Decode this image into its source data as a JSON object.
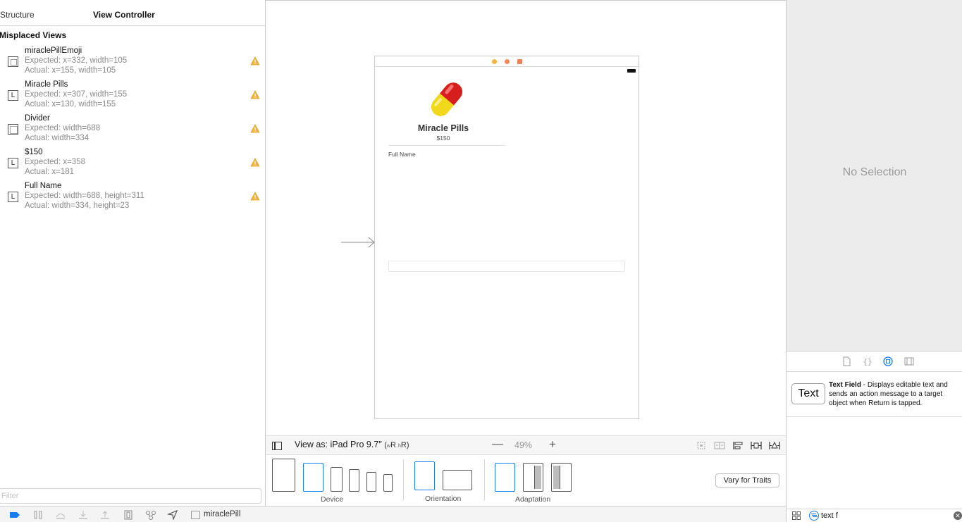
{
  "left_panel": {
    "tabs": {
      "structure": "Structure",
      "view_controller": "View Controller"
    },
    "section_heading": "Misplaced Views",
    "issues": [
      {
        "name": "miraclePillEmoji",
        "expected": "Expected: x=332, width=105",
        "actual": "Actual: x=155, width=105",
        "type_icon": "image-view-icon"
      },
      {
        "name": "Miracle Pills",
        "expected": "Expected: x=307, width=155",
        "actual": "Actual: x=130, width=155",
        "type_icon": "label-icon",
        "type_glyph": "L"
      },
      {
        "name": "Divider",
        "expected": "Expected: width=688",
        "actual": "Actual: width=334",
        "type_icon": "view-icon"
      },
      {
        "name": "$150",
        "expected": "Expected: x=358",
        "actual": "Actual: x=181",
        "type_icon": "label-icon",
        "type_glyph": "L"
      },
      {
        "name": "Full Name",
        "expected": "Expected: width=688, height=311",
        "actual": "Actual: width=334, height=23",
        "type_icon": "label-icon",
        "type_glyph": "L"
      }
    ],
    "filter": {
      "placeholder": "Filter",
      "value": ""
    }
  },
  "scene": {
    "emoji": "💊",
    "title": "Miracle Pills",
    "price": "$150",
    "full_name_label": "Full Name",
    "text_field_value": ""
  },
  "canvas_bar": {
    "view_as": "View as: iPad Pro 9.7″",
    "trait_w": "w",
    "trait_w_class": "R",
    "trait_h": "h",
    "trait_h_class": "R",
    "zoom_out": "—",
    "zoom_level": "49%",
    "zoom_in": "+"
  },
  "config_bar": {
    "device_label": "Device",
    "orientation_label": "Orientation",
    "adaptation_label": "Adaptation",
    "vary_button": "Vary for Traits"
  },
  "debug_bar": {
    "breadcrumb": "miraclePill"
  },
  "inspector": {
    "no_selection": "No Selection"
  },
  "library": {
    "item_icon_text": "Text",
    "item_title": "Text Field",
    "item_description": " - Displays editable text and sends an action message to a target object when Return is tapped.",
    "search_value": "text f"
  },
  "colors": {
    "accent": "#1a7cf2",
    "warning": "#f5b43c",
    "inspector_bg": "#ececec"
  }
}
